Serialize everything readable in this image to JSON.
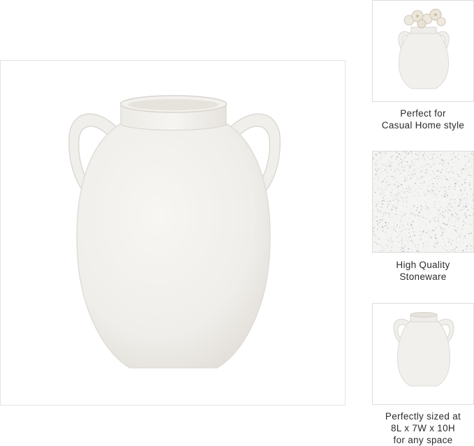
{
  "main_image": {
    "alt": "",
    "icon": "vase-icon"
  },
  "features": [
    {
      "icon": "vase-with-flowers-icon",
      "caption_lines": [
        "Perfect for",
        "Casual Home style"
      ]
    },
    {
      "icon": "stone-texture-icon",
      "caption_lines": [
        "High Quality",
        "Stoneware"
      ]
    },
    {
      "icon": "vase-icon",
      "caption_lines": [
        "Perfectly sized at",
        "8L x 7W x 10H",
        "for any space"
      ]
    }
  ],
  "colors": {
    "vase_body": "#f1efeb",
    "vase_shadow": "#e4e1dc",
    "border": "#e3e3e3",
    "caption_text": "#2b2b2b"
  }
}
